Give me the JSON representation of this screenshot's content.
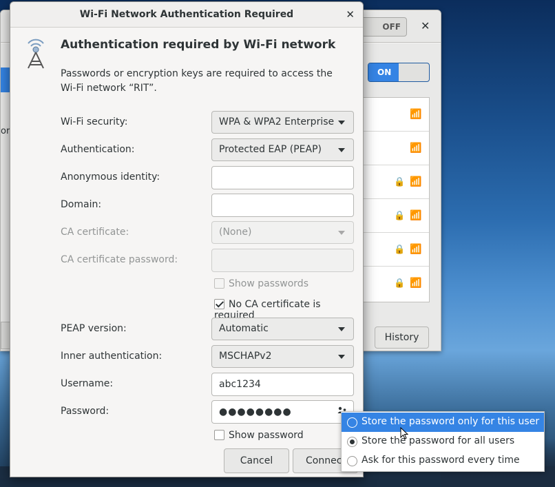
{
  "background_window": {
    "off_label": "OFF",
    "on_label": "ON",
    "history_label": "History",
    "side_text": "ork"
  },
  "dialog": {
    "title": "Wi-Fi Network Authentication Required",
    "heading": "Authentication required by Wi-Fi network",
    "description": "Passwords or encryption keys are required to access the Wi-Fi network “RIT”.",
    "fields": {
      "wifi_security": {
        "label": "Wi-Fi security:",
        "value": "WPA & WPA2 Enterprise"
      },
      "authentication": {
        "label": "Authentication:",
        "value": "Protected EAP (PEAP)"
      },
      "anonymous_identity": {
        "label": "Anonymous identity:",
        "value": ""
      },
      "domain": {
        "label": "Domain:",
        "value": ""
      },
      "ca_certificate": {
        "label": "CA certificate:",
        "value": "(None)"
      },
      "ca_certificate_password": {
        "label": "CA certificate password:",
        "value": ""
      },
      "show_passwords": {
        "label": "Show passwords",
        "checked": false
      },
      "no_ca_required": {
        "label": "No CA certificate is required",
        "checked": true
      },
      "peap_version": {
        "label": "PEAP version:",
        "value": "Automatic"
      },
      "inner_authentication": {
        "label": "Inner authentication:",
        "value": "MSCHAPv2"
      },
      "username": {
        "label": "Username:",
        "value": "abc1234"
      },
      "password": {
        "label": "Password:",
        "value": "●●●●●●●●"
      },
      "show_password": {
        "label": "Show password",
        "checked": false
      }
    },
    "buttons": {
      "cancel": "Cancel",
      "connect": "Connect"
    }
  },
  "password_menu": {
    "items": [
      {
        "label": "Store the password only for this user",
        "selected": false,
        "highlighted": true
      },
      {
        "label": "Store the password for all users",
        "selected": true,
        "highlighted": false
      },
      {
        "label": "Ask for this password every time",
        "selected": false,
        "highlighted": false
      }
    ]
  },
  "colors": {
    "accent": "#3584e4",
    "window_bg": "#f6f5f4"
  }
}
